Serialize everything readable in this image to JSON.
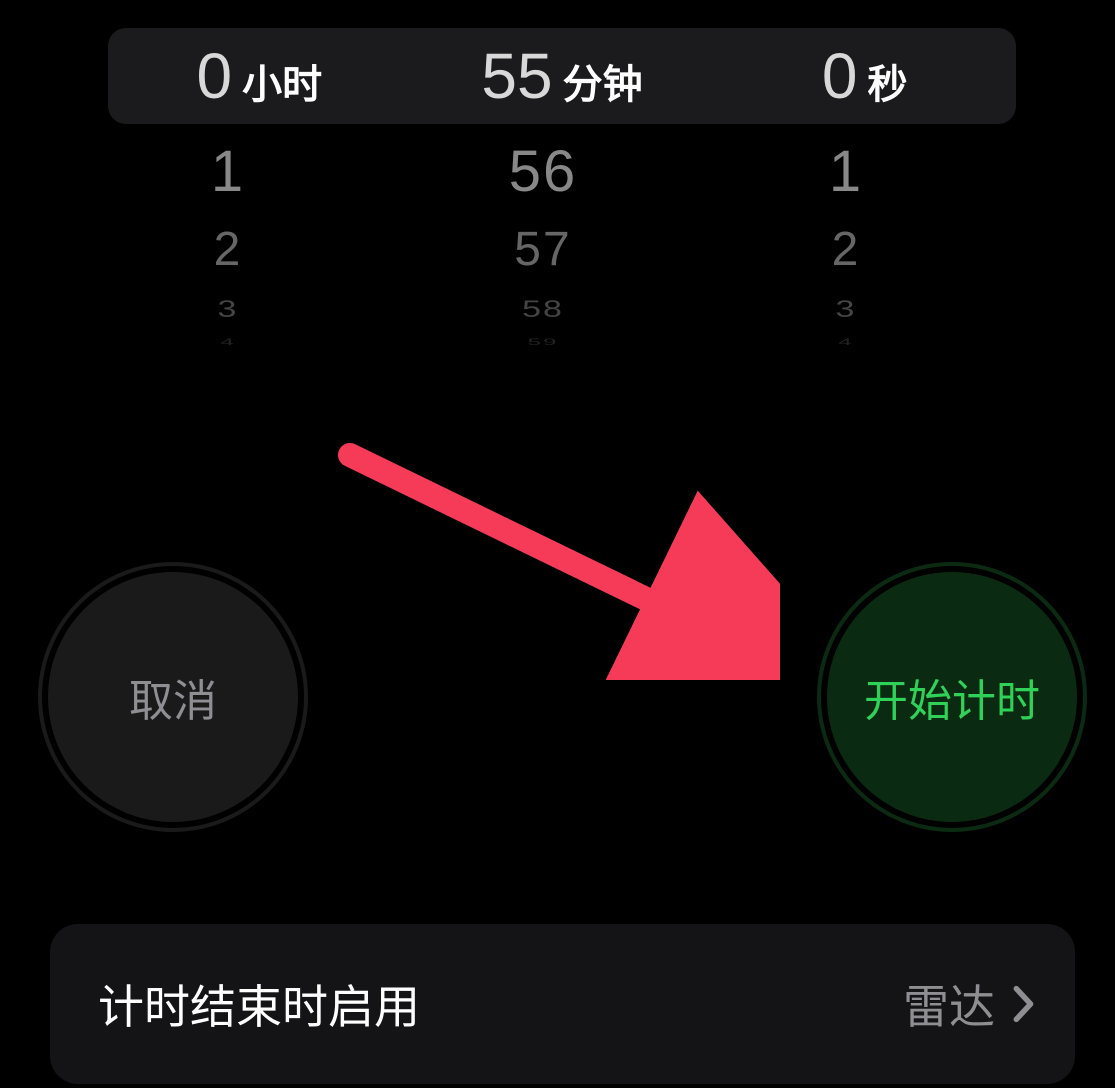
{
  "picker": {
    "hours": {
      "selected": "0",
      "unit": "小时",
      "below": [
        "1",
        "2",
        "3",
        "4"
      ]
    },
    "minutes": {
      "selected": "55",
      "unit": "分钟",
      "below": [
        "56",
        "57",
        "58",
        "59"
      ]
    },
    "seconds": {
      "selected": "0",
      "unit": "秒",
      "below": [
        "1",
        "2",
        "3",
        "4"
      ]
    }
  },
  "buttons": {
    "cancel_label": "取消",
    "start_label": "开始计时"
  },
  "end_row": {
    "label": "计时结束时启用",
    "value": "雷达"
  },
  "colors": {
    "accent_green": "#30d158",
    "annotation_red": "#f53b57"
  }
}
